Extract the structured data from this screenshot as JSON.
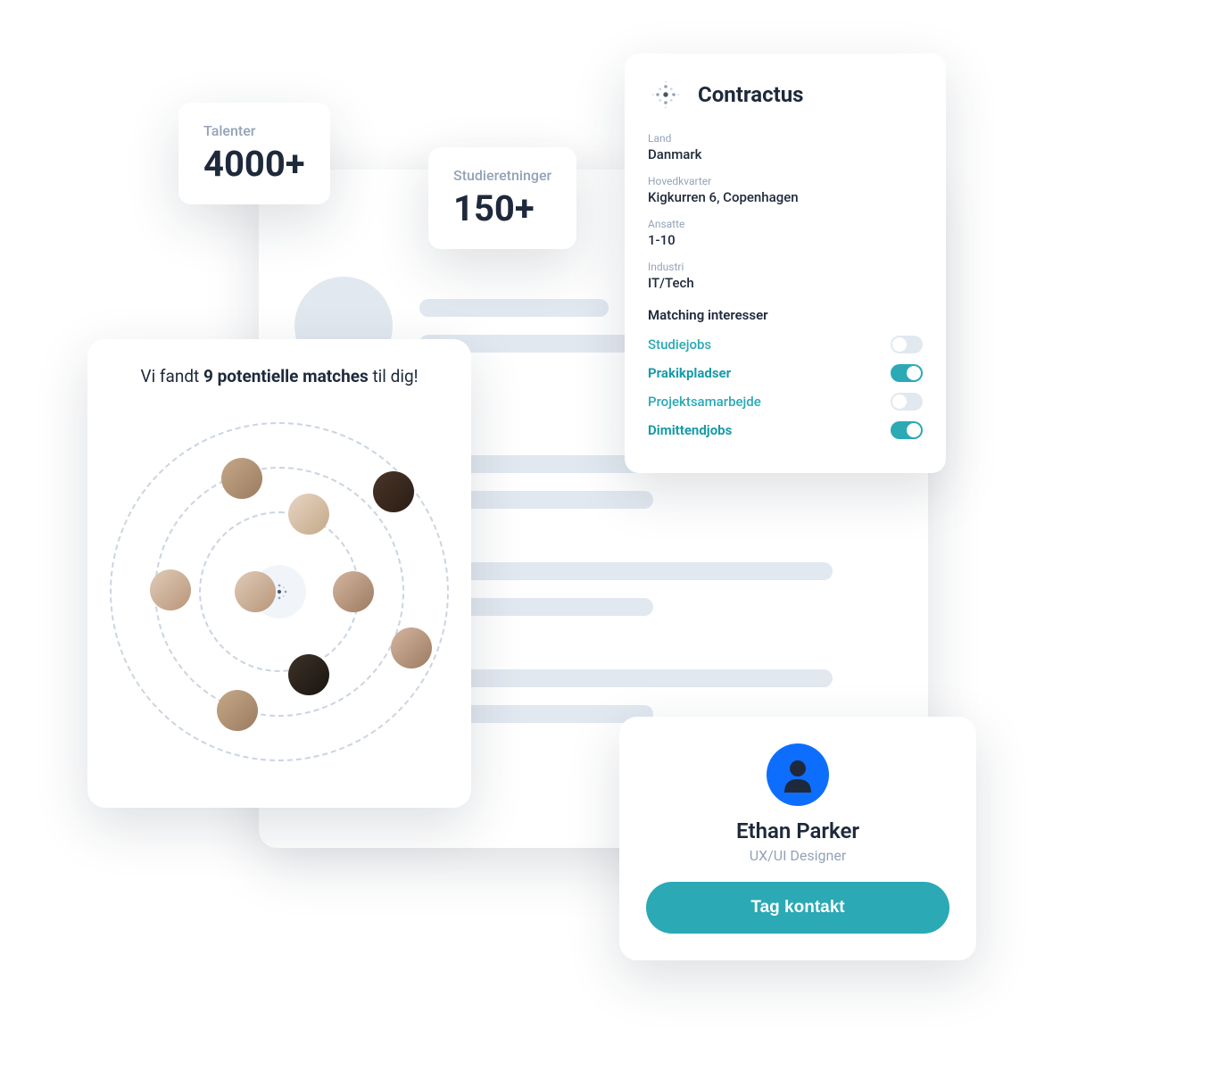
{
  "stats": {
    "talenter": {
      "label": "Talenter",
      "value": "4000+"
    },
    "studieretninger": {
      "label": "Studieretninger",
      "value": "150+"
    }
  },
  "company": {
    "name": "Contractus",
    "fields": {
      "land": {
        "label": "Land",
        "value": "Danmark"
      },
      "hovedkvarter": {
        "label": "Hovedkvarter",
        "value": "Kigkurren 6, Copenhagen"
      },
      "ansatte": {
        "label": "Ansatte",
        "value": "1-10"
      },
      "industri": {
        "label": "Industri",
        "value": "IT/Tech"
      }
    },
    "interests_title": "Matching interesser",
    "interests": [
      {
        "label": "Studiejobs",
        "on": false
      },
      {
        "label": "Prakikpladser",
        "on": true
      },
      {
        "label": "Projektsamarbejde",
        "on": false
      },
      {
        "label": "Dimittendjobs",
        "on": true
      }
    ]
  },
  "matches": {
    "title_prefix": "Vi fandt ",
    "title_bold": "9 potentielle matches",
    "title_suffix": " til dig!"
  },
  "profile": {
    "name": "Ethan Parker",
    "role": "UX/UI Designer",
    "contact_button": "Tag kontakt"
  },
  "colors": {
    "accent": "#2ba9b5",
    "text_dark": "#1e293b",
    "text_muted": "#94a3b8"
  }
}
